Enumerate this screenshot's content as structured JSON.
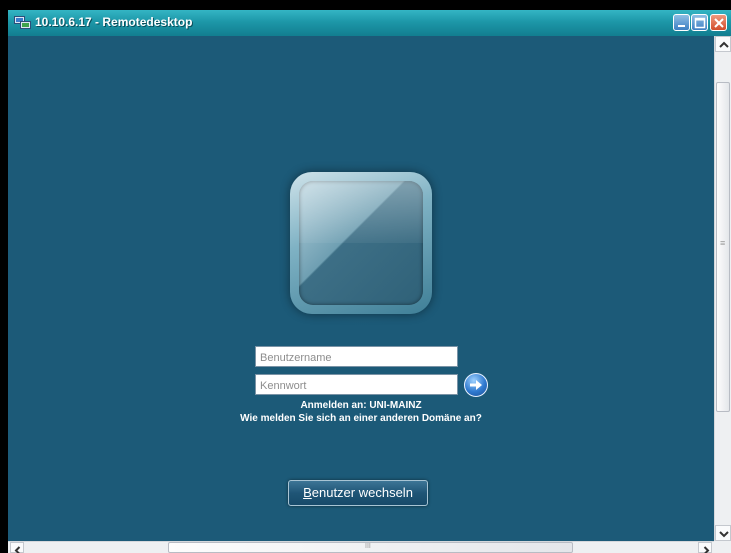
{
  "window": {
    "title": "10.10.6.17 - Remotedesktop",
    "controls": [
      "minimize",
      "maximize",
      "close"
    ]
  },
  "login": {
    "username_placeholder": "Benutzername",
    "password_placeholder": "Kennwort",
    "domain_text": "Anmelden an: UNI-MAINZ",
    "other_domain_text": "Wie melden Sie sich an einer anderen Domäne an?",
    "switch_user": {
      "accelerator": "B",
      "rest": "enutzer wechseln"
    }
  },
  "scrollbars": {
    "horizontal_grip": "III",
    "vertical_grip": "≡"
  },
  "colors": {
    "background": "#1c5a78",
    "titlebar": "#1d97a8"
  },
  "icons": {
    "title": "remote-desktop-icon",
    "go": "arrow-right-icon"
  }
}
